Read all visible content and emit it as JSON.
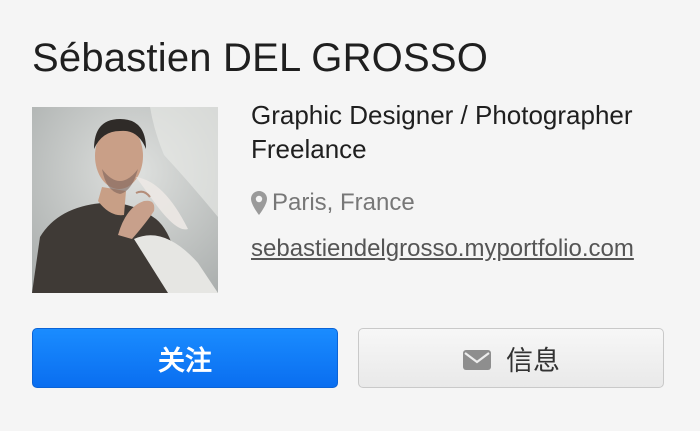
{
  "profile": {
    "name": "Sébastien DEL GROSSO",
    "role_line1": "Graphic Designer / Photographer",
    "role_line2": "Freelance",
    "location": "Paris, France",
    "website": "sebastiendelgrosso.myportfolio.com"
  },
  "icons": {
    "location": "map-pin-icon",
    "message": "envelope-icon"
  },
  "buttons": {
    "follow_label": "关注",
    "message_label": "信息"
  },
  "colors": {
    "follow_button": "#0a6ef0",
    "message_button": "#eeeeee",
    "background": "#f5f5f5"
  }
}
